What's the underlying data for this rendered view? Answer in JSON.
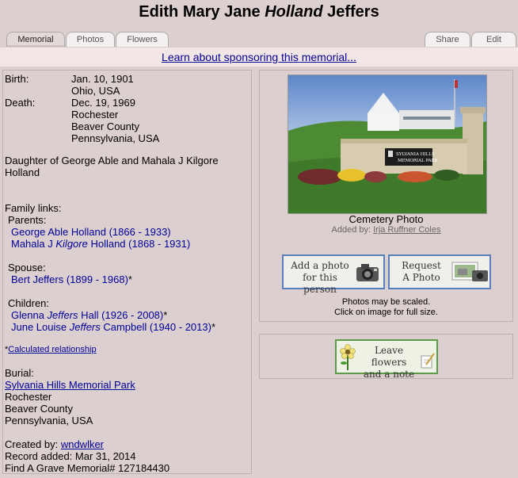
{
  "title": {
    "first": "Edith Mary Jane ",
    "italic": "Holland",
    "last": " Jeffers"
  },
  "tabs": {
    "memorial": "Memorial",
    "photos": "Photos",
    "flowers": "Flowers",
    "share": "Share",
    "edit": "Edit"
  },
  "sponsor_link": "Learn about sponsoring this memorial...",
  "birth": {
    "label": "Birth:",
    "date": "Jan. 10, 1901",
    "place": "Ohio, USA"
  },
  "death": {
    "label": "Death:",
    "date": "Dec. 19, 1969",
    "lines": [
      "Rochester",
      "Beaver County",
      "Pennsylvania, USA"
    ]
  },
  "bio": {
    "line1": "Daughter of George Able and Mahala J Kilgore",
    "line2": "Holland"
  },
  "family": {
    "heading": "Family links:",
    "parents_label": "Parents:",
    "parent1": "George Able Holland (1866 - 1933)",
    "parent2_pre": "Mahala J ",
    "parent2_italic": "Kilgore",
    "parent2_post": " Holland (1868 - 1931)",
    "spouse_label": "Spouse:",
    "spouse": "Bert Jeffers (1899 - 1968)",
    "spouse_mark": "*",
    "children_label": "Children:",
    "child1_pre": "Glenna ",
    "child1_italic": "Jeffers",
    "child1_post": " Hall (1926 - 2008)",
    "child1_mark": "*",
    "child2_pre": "June Louise ",
    "child2_italic": "Jeffers",
    "child2_post": " Campbell (1940 - 2013)",
    "child2_mark": "*",
    "calc_star": "*",
    "calc_link": "Calculated relationship"
  },
  "burial": {
    "label": "Burial:",
    "cemetery": "Sylvania Hills Memorial Park",
    "lines": [
      "Rochester",
      "Beaver County",
      "Pennsylvania, USA"
    ]
  },
  "created": {
    "label": "Created by: ",
    "user": "wndwlker",
    "added": "Record added: Mar 31, 2014",
    "memorial": "Find A Grave Memorial# 127184430"
  },
  "photo": {
    "sign_line1": "SYLVANIA HILLS",
    "sign_line2": "MEMORIAL PARK",
    "caption": "Cemetery Photo",
    "added_by_label": "Added by: ",
    "added_by": "Irja Ruffner Coles"
  },
  "buttons": {
    "add_photo_line1": "Add a photo",
    "add_photo_line2": "for this person",
    "request_line1": "Request",
    "request_line2": "A Photo",
    "flowers_line1": "Leave flowers",
    "flowers_line2": "and a note"
  },
  "notes": {
    "scaled": "Photos may be scaled.",
    "click": "Click on image for full size."
  }
}
